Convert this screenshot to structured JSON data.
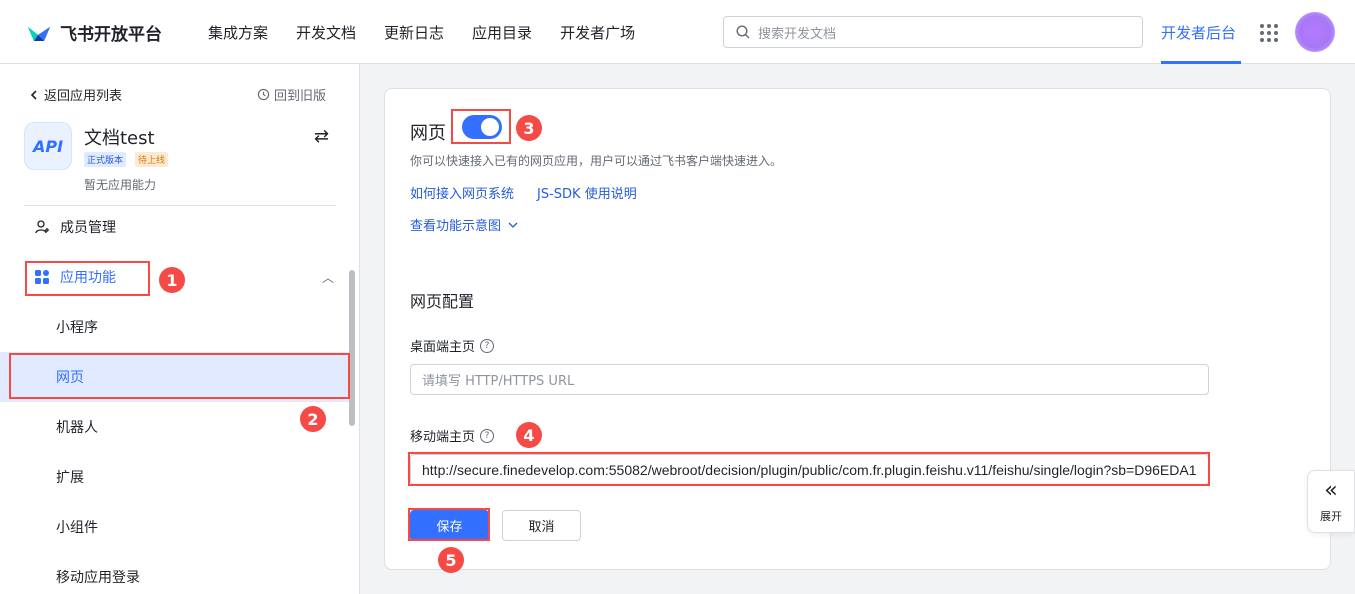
{
  "header": {
    "brand": "飞书开放平台",
    "nav": [
      "集成方案",
      "开发文档",
      "更新日志",
      "应用目录",
      "开发者广场"
    ],
    "search_placeholder": "搜索开发文档",
    "dev_console": "开发者后台"
  },
  "sidebar": {
    "back_label": "返回应用列表",
    "old_version_label": "回到旧版",
    "app_icon_text": "API",
    "app_name": "文档test",
    "badge_release": "正式版本",
    "badge_pending": "待上线",
    "no_ability": "暂无应用能力",
    "members": "成员管理",
    "app_features": "应用功能",
    "sub_items": [
      "小程序",
      "网页",
      "机器人",
      "扩展",
      "小组件",
      "移动应用登录"
    ]
  },
  "main": {
    "title": "网页",
    "toggle_on": true,
    "description": "你可以快速接入已有的网页应用，用户可以通过飞书客户端快速进入。",
    "link_integrate": "如何接入网页系统",
    "link_jssdk": "JS-SDK 使用说明",
    "link_preview": "查看功能示意图",
    "section_title": "网页配置",
    "desktop_label": "桌面端主页",
    "desktop_placeholder": "请填写 HTTP/HTTPS URL",
    "mobile_label": "移动端主页",
    "mobile_value": "http://secure.finedevelop.com:55082/webroot/decision/plugin/public/com.fr.plugin.feishu.v11/feishu/single/login?sb=D96EDA1",
    "save_label": "保存",
    "cancel_label": "取消"
  },
  "annotations": [
    "1",
    "2",
    "3",
    "4",
    "5"
  ],
  "expand": {
    "label": "展开"
  },
  "colors": {
    "accent": "#3370ff",
    "annotation": "#f54a45",
    "active_bg": "#e1eaff"
  }
}
